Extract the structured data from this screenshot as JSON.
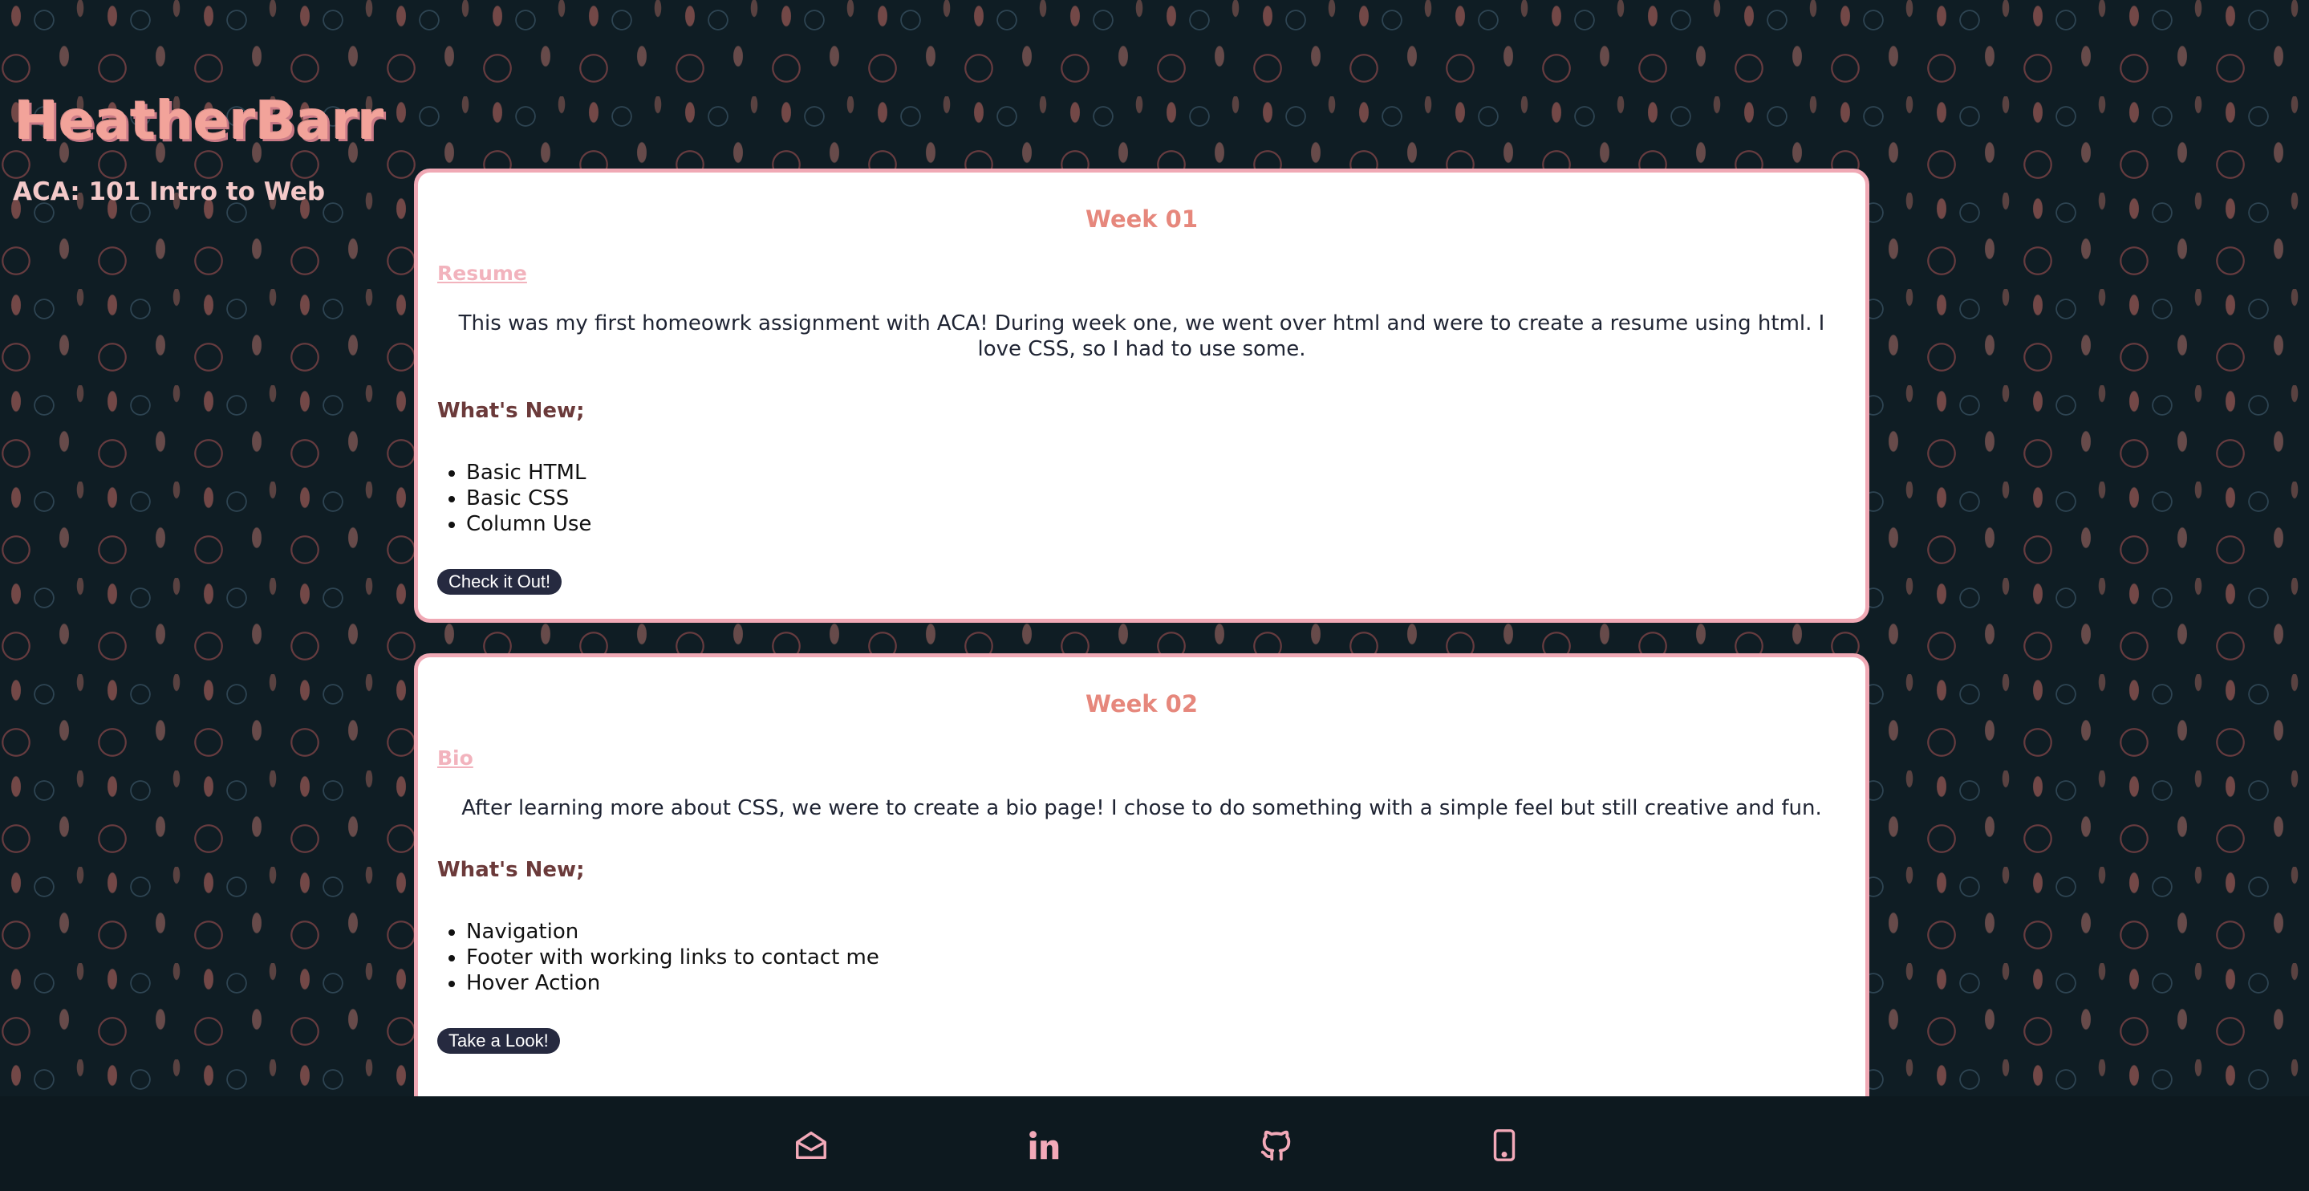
{
  "brand": {
    "name": "HeatherBarr",
    "subtitle": "ACA: 101 Intro to Web"
  },
  "weeks": [
    {
      "title": "Week 01",
      "project_link": "Resume",
      "description": "This was my first homeowrk assignment with ACA! During week one, we went over html and were to create a resume using html. I love CSS, so I had to use some.",
      "whats_new_label": "What's New;",
      "features": [
        "Basic HTML",
        "Basic CSS",
        "Column Use"
      ],
      "button_label": "Check it Out!"
    },
    {
      "title": "Week 02",
      "project_link": "Bio",
      "description": "After learning more about CSS, we were to create a bio page! I chose to do something with a simple feel but still creative and fun.",
      "whats_new_label": "What's New;",
      "features": [
        "Navigation",
        "Footer with working links to contact me",
        "Hover Action"
      ],
      "button_label": "Take a Look!"
    }
  ],
  "footer": {
    "icons": [
      "email-icon",
      "linkedin-icon",
      "github-icon",
      "phone-icon"
    ],
    "icon_color": "#f2a9b8"
  },
  "colors": {
    "background": "#0f1d24",
    "accent": "#e6877c",
    "card_border": "#f0a9b5",
    "button": "#262a40"
  }
}
